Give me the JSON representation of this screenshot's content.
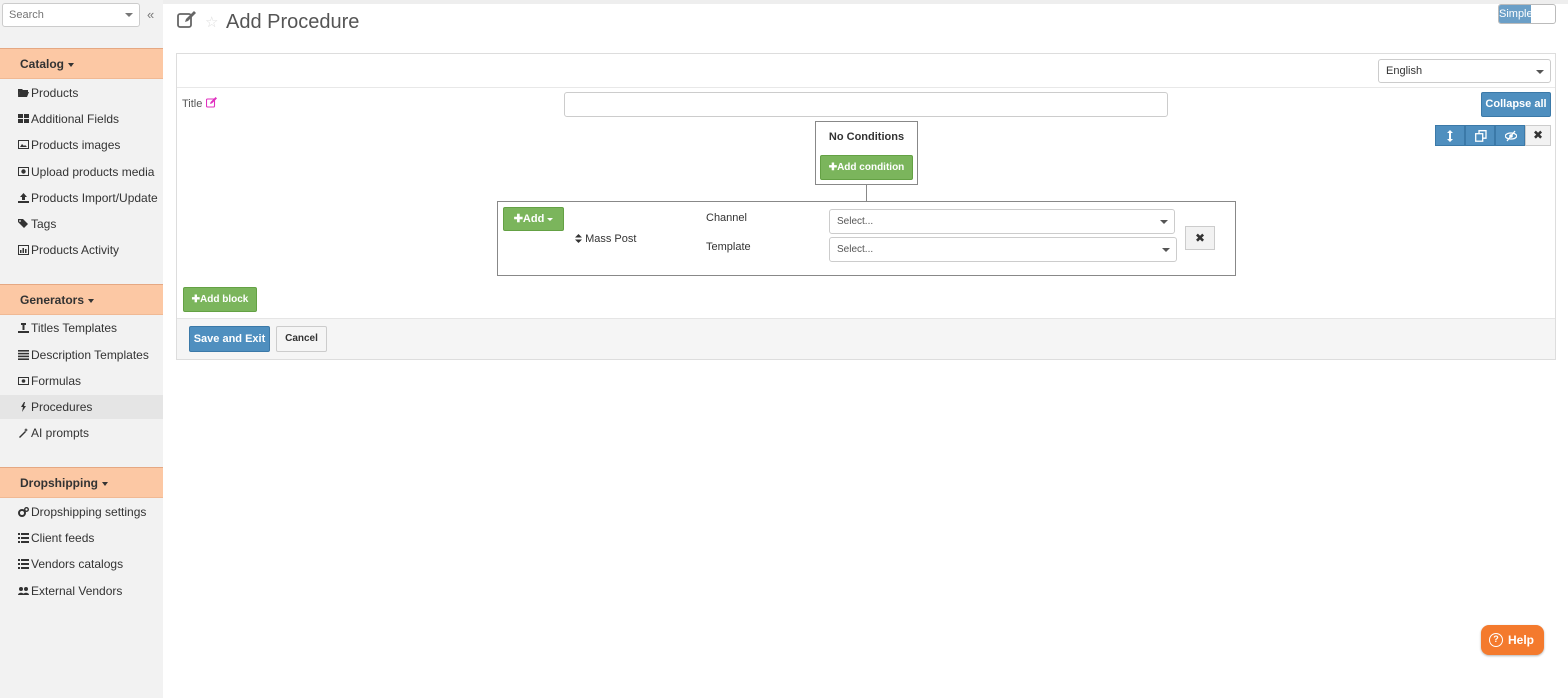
{
  "sidebar": {
    "search_placeholder": "Search",
    "collapse_glyph": "«",
    "sections": [
      {
        "title": "Catalog",
        "items": [
          {
            "label": "Products",
            "icon": "folder-open-icon"
          },
          {
            "label": "Additional Fields",
            "icon": "grid-icon"
          },
          {
            "label": "Products images",
            "icon": "image-icon"
          },
          {
            "label": "Upload products media",
            "icon": "media-icon"
          },
          {
            "label": "Products Import/Update",
            "icon": "upload-icon"
          },
          {
            "label": "Tags",
            "icon": "tags-icon"
          },
          {
            "label": "Products Activity",
            "icon": "bar-chart-icon"
          }
        ]
      },
      {
        "title": "Generators",
        "items": [
          {
            "label": "Titles Templates",
            "icon": "text-height-icon"
          },
          {
            "label": "Description Templates",
            "icon": "align-justify-icon"
          },
          {
            "label": "Formulas",
            "icon": "money-icon"
          },
          {
            "label": "Procedures",
            "icon": "bolt-icon",
            "active": true
          },
          {
            "label": "AI prompts",
            "icon": "magic-wand-icon"
          }
        ]
      },
      {
        "title": "Dropshipping",
        "items": [
          {
            "label": "Dropshipping settings",
            "icon": "cogs-icon"
          },
          {
            "label": "Client feeds",
            "icon": "list-icon"
          },
          {
            "label": "Vendors catalogs",
            "icon": "list-icon"
          },
          {
            "label": "External Vendors",
            "icon": "users-icon"
          }
        ]
      }
    ]
  },
  "header": {
    "page_title": "Add Procedure",
    "mode_toggle_label": "Simple"
  },
  "form": {
    "language": "English",
    "title_label": "Title",
    "title_value": "",
    "collapse_all_label": "Collapse all",
    "tool_close_glyph": "✖",
    "conditions": {
      "title": "No Conditions",
      "add_condition_label": "Add condition"
    },
    "block": {
      "add_label": "Add",
      "action_name": "Mass Post",
      "channel_label": "Channel",
      "channel_value": "Select...",
      "template_label": "Template",
      "template_value": "Select...",
      "remove_glyph": "✖"
    },
    "add_block_label": "Add block",
    "save_exit_label": "Save and Exit",
    "cancel_label": "Cancel"
  },
  "help": {
    "label": "Help",
    "icon_glyph": "?"
  },
  "colors": {
    "section_header": "#fcc8a4",
    "primary_blue": "#4f8fbf",
    "success_green": "#7bb55c",
    "help_orange": "#f47a2d"
  }
}
